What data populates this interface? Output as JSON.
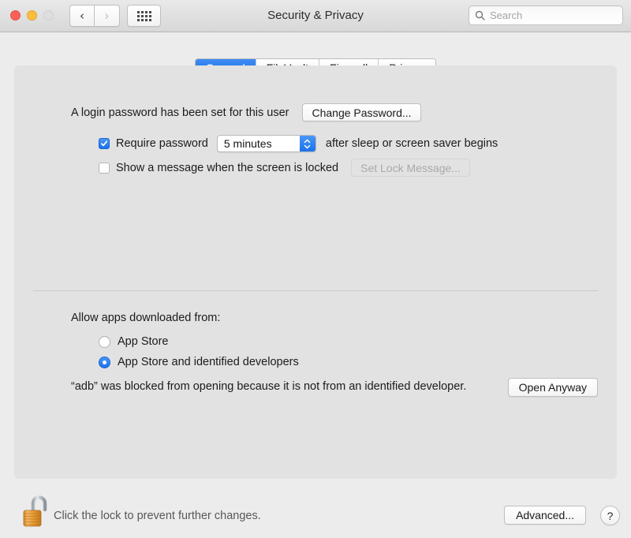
{
  "window": {
    "title": "Security & Privacy",
    "traffic_lights": [
      "close",
      "minimize",
      "zoom-disabled"
    ],
    "nav_back_icon": "chevron-left-icon",
    "nav_forward_icon": "chevron-right-icon",
    "show_all_icon": "grid-icon",
    "search": {
      "icon": "search-icon",
      "placeholder": "Search",
      "value": ""
    }
  },
  "tabs": [
    {
      "label": "General",
      "active": true
    },
    {
      "label": "FileVault",
      "active": false
    },
    {
      "label": "Firewall",
      "active": false
    },
    {
      "label": "Privacy",
      "active": false
    }
  ],
  "general": {
    "password_status": "A login password has been set for this user",
    "change_password_button": "Change Password...",
    "require_password": {
      "checked": true,
      "label_before": "Require password",
      "delay_value": "5 minutes",
      "label_after": "after sleep or screen saver begins"
    },
    "lock_message": {
      "checked": false,
      "label": "Show a message when the screen is locked",
      "button": "Set Lock Message...",
      "button_disabled": true
    },
    "allow_apps_heading": "Allow apps downloaded from:",
    "allow_apps_options": [
      {
        "label": "App Store",
        "selected": false
      },
      {
        "label": "App Store and identified developers",
        "selected": true
      }
    ],
    "blocked_message": "“adb” was blocked from opening because it is not from an identified developer.",
    "open_anyway_button": "Open Anyway"
  },
  "footer": {
    "lock_icon": "unlocked-padlock-icon",
    "lock_text": "Click the lock to prevent further changes.",
    "advanced_button": "Advanced...",
    "help_button": "?"
  },
  "colors": {
    "accent_blue": "#1a72ec",
    "window_bg": "#ececec",
    "panel_bg": "#e2e2e2",
    "lock_gold": "#e8a33d"
  }
}
